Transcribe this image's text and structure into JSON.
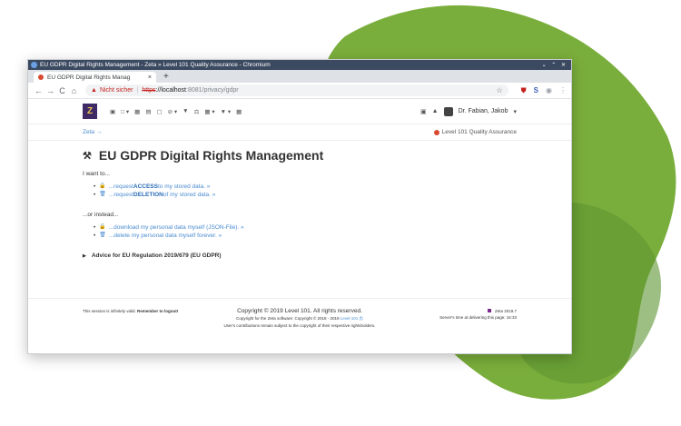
{
  "window": {
    "title": "EU GDPR Digital Rights Management - Zeta » Level 101 Quality Assurance - Chromium",
    "controls": "⌄ ⌃ ✕"
  },
  "tab": {
    "label": "EU GDPR Digital Rights Manag",
    "close": "×",
    "new": "+"
  },
  "toolbar": {
    "back": "←",
    "forward": "→",
    "reload": "C",
    "home": "⌂",
    "warning_icon": "▲",
    "not_secure": "Nicht sicher",
    "scheme": "https",
    "host": "://localhost",
    "path": ":8081/privacy/gdpr",
    "star": "☆"
  },
  "apptop": {
    "logo": "Z",
    "icons": [
      "▣",
      "□ ▾",
      "▦",
      "▤",
      "▢",
      "⊘ ▾",
      "▼",
      "⚖",
      "▦ ▾",
      "▼ ▾",
      "▦"
    ],
    "notif_icon": "▣",
    "bell_icon": "▲",
    "user": "Dr. Fabian, Jakob",
    "user_caret": "▾"
  },
  "crumbs": {
    "root": "Zeta →",
    "org": "Level 101 Quality Assurance"
  },
  "main": {
    "title": "EU GDPR Digital Rights Management",
    "intro": "I want to...",
    "want_items": [
      {
        "pre": "...request ",
        "bold": "ACCESS",
        "post": " to my stored data. »",
        "icon": "🔒"
      },
      {
        "pre": "...request ",
        "bold": "DELETION",
        "post": " of my stored data. »",
        "icon": "🗑"
      }
    ],
    "instead": "...or instead...",
    "instead_items": [
      {
        "text": "...download my personal data myself (JSON-File). »",
        "icon": "🔒"
      },
      {
        "text": "...delete my personal data myself forever. »",
        "icon": "🗑"
      }
    ],
    "advice": "Advice for EU Regulation 2019/679 (EU GDPR)"
  },
  "footer": {
    "left_text": "This session is infinitely valid. ",
    "left_bold": "Remember to logout!",
    "copyright": "Copyright © 2019 Level 101. All rights reserved.",
    "line2": "Copyright for the Zeta software: Copyright © 2018 - 2019 ",
    "line2_link": "Level 101 (f)",
    "line3": "User's contributions remain subject to the copyright of their respective rightsholders.",
    "version": "Zeta 2019.7",
    "server_time": "Server's time at delivering this page: 16:33"
  },
  "colors": {
    "accent": "#4a8bd0",
    "brand": "#3f2a66",
    "blob": "#7aae3c"
  }
}
